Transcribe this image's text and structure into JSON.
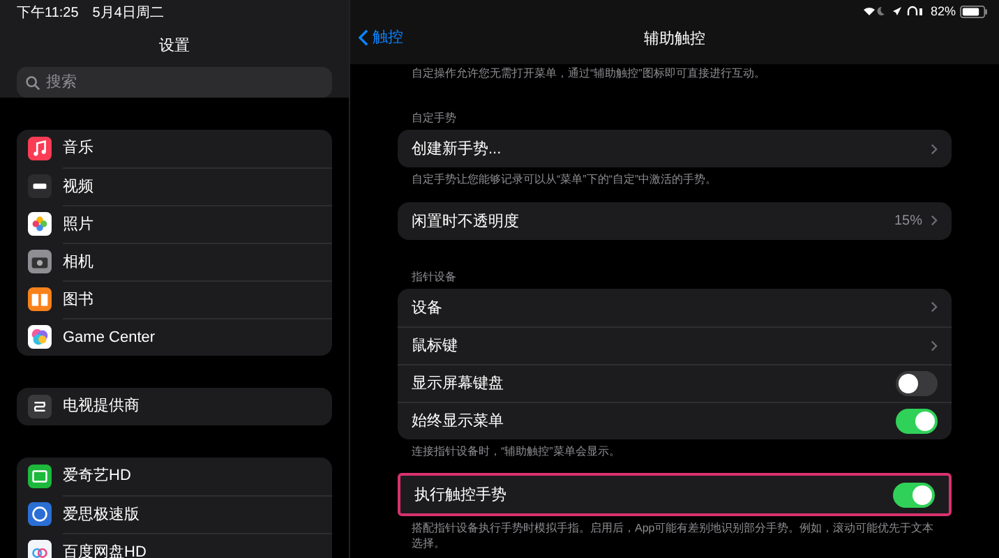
{
  "status_bar": {
    "time": "下午11:25",
    "date": "5月4日周二",
    "battery": "82%"
  },
  "sidebar": {
    "title": "设置",
    "search": {
      "placeholder": "搜索"
    },
    "groups": [
      {
        "items": [
          {
            "label": "音乐",
            "color": "#fa3c55"
          },
          {
            "label": "视频",
            "color": "#2c2c2e"
          },
          {
            "label": "照片",
            "color": "#ffffff"
          },
          {
            "label": "相机",
            "color": "#8e8e93"
          },
          {
            "label": "图书",
            "color": "#f7821b"
          },
          {
            "label": "Game Center",
            "color": "#ffffff"
          }
        ]
      },
      {
        "items": [
          {
            "label": "电视提供商",
            "color": "#3a3a3c"
          }
        ]
      },
      {
        "items": [
          {
            "label": "爱奇艺HD",
            "color": "#1db83c"
          },
          {
            "label": "爱思极速版",
            "color": "#2b6fd6"
          },
          {
            "label": "百度网盘HD",
            "color": "#f2f6fb"
          }
        ]
      }
    ]
  },
  "detail": {
    "back": "触控",
    "title": "辅助触控",
    "sections": [
      {
        "footer": "自定操作允许您无需打开菜单，通过“辅助触控”图标即可直接进行互动。"
      },
      {
        "header": "自定手势",
        "rows": [
          {
            "kind": "chevron",
            "label": "创建新手势...",
            "highlighted": false
          }
        ],
        "footer": "自定手势让您能够记录可以从“菜单”下的“自定”中激活的手势。"
      },
      {
        "rows": [
          {
            "kind": "value",
            "label": "闲置时不透明度",
            "value": "15%",
            "highlighted": false
          }
        ]
      },
      {
        "header": "指针设备",
        "rows": [
          {
            "kind": "chevron",
            "label": "设备",
            "highlighted": false
          },
          {
            "kind": "chevron",
            "label": "鼠标键",
            "highlighted": false
          },
          {
            "kind": "toggle",
            "label": "显示屏幕键盘",
            "on": false,
            "highlighted": false
          },
          {
            "kind": "toggle",
            "label": "始终显示菜单",
            "on": true,
            "highlighted": false
          }
        ],
        "footer": "连接指针设备时，“辅助触控”菜单会显示。"
      },
      {
        "rows": [
          {
            "kind": "toggle",
            "label": "执行触控手势",
            "on": true,
            "highlighted": true
          }
        ],
        "footer": "搭配指针设备执行手势时模拟手指。启用后，App可能有差别地识别部分手势。例如，滚动可能优先于文本选择。"
      }
    ]
  }
}
